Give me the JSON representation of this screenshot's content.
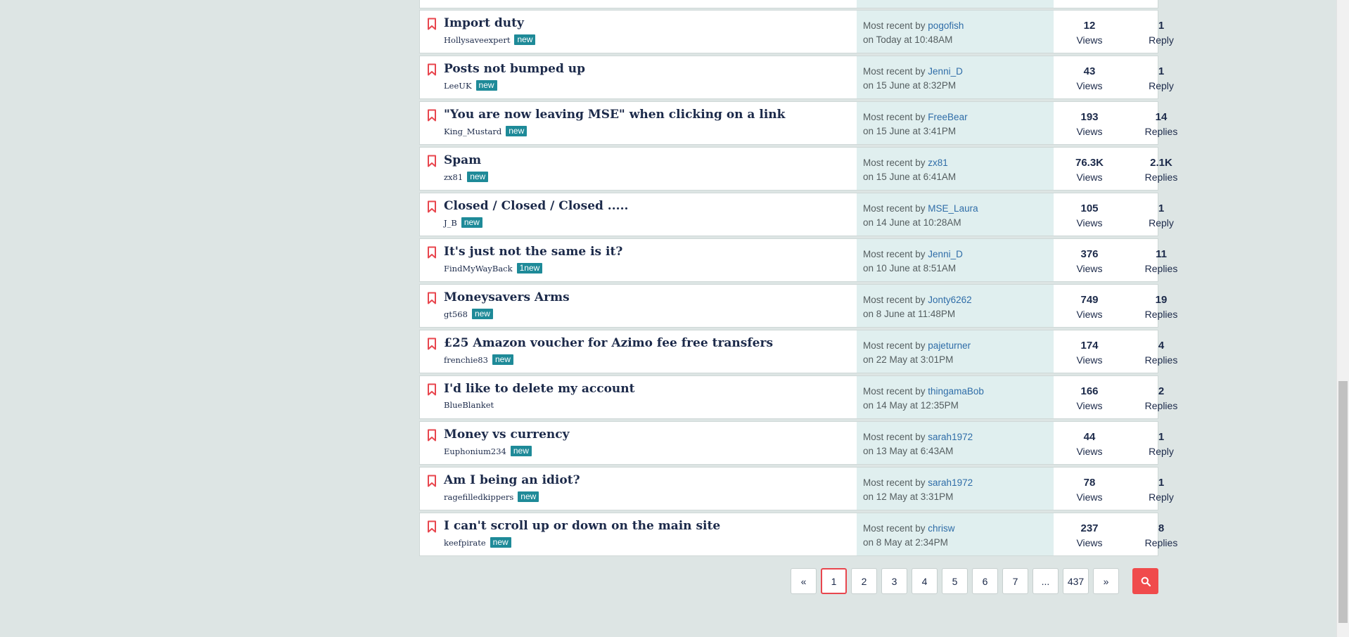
{
  "threads": [
    {
      "title": "Import duty",
      "author": "Hollysaveexpert",
      "badge": "new",
      "recent_prefix": "Most recent by ",
      "recent_user": "pogofish",
      "recent_time": "on Today at 10:48AM",
      "views": "12",
      "views_label": "Views",
      "replies": "1",
      "replies_label": "Reply"
    },
    {
      "title": "Posts not bumped up",
      "author": "LeeUK",
      "badge": "new",
      "recent_prefix": "Most recent by ",
      "recent_user": "Jenni_D",
      "recent_time": "on 15 June at 8:32PM",
      "views": "43",
      "views_label": "Views",
      "replies": "1",
      "replies_label": "Reply"
    },
    {
      "title": "\"You are now leaving MSE\" when clicking on a link",
      "author": "King_Mustard",
      "badge": "new",
      "recent_prefix": "Most recent by ",
      "recent_user": "FreeBear",
      "recent_time": "on 15 June at 3:41PM",
      "views": "193",
      "views_label": "Views",
      "replies": "14",
      "replies_label": "Replies"
    },
    {
      "title": "Spam",
      "author": "zx81",
      "badge": "new",
      "recent_prefix": "Most recent by ",
      "recent_user": "zx81",
      "recent_time": "on 15 June at 6:41AM",
      "views": "76.3K",
      "views_label": "Views",
      "replies": "2.1K",
      "replies_label": "Replies"
    },
    {
      "title": "Closed / Closed / Closed .....",
      "author": "J_B",
      "badge": "new",
      "recent_prefix": "Most recent by ",
      "recent_user": "MSE_Laura",
      "recent_time": "on 14 June at 10:28AM",
      "views": "105",
      "views_label": "Views",
      "replies": "1",
      "replies_label": "Reply"
    },
    {
      "title": "It's just not the same is it?",
      "author": "FindMyWayBack",
      "badge": "1new",
      "recent_prefix": "Most recent by ",
      "recent_user": "Jenni_D",
      "recent_time": "on 10 June at 8:51AM",
      "views": "376",
      "views_label": "Views",
      "replies": "11",
      "replies_label": "Replies"
    },
    {
      "title": "Moneysavers Arms",
      "author": "gt568",
      "badge": "new",
      "recent_prefix": "Most recent by ",
      "recent_user": "Jonty6262",
      "recent_time": "on 8 June at 11:48PM",
      "views": "749",
      "views_label": "Views",
      "replies": "19",
      "replies_label": "Replies"
    },
    {
      "title": "£25 Amazon voucher for Azimo fee free transfers",
      "author": "frenchie83",
      "badge": "new",
      "recent_prefix": "Most recent by ",
      "recent_user": "pajeturner",
      "recent_time": "on 22 May at 3:01PM",
      "views": "174",
      "views_label": "Views",
      "replies": "4",
      "replies_label": "Replies"
    },
    {
      "title": "I'd like to delete my account",
      "author": "BlueBlanket",
      "badge": "",
      "recent_prefix": "Most recent by ",
      "recent_user": "thingamaBob",
      "recent_time": "on 14 May at 12:35PM",
      "views": "166",
      "views_label": "Views",
      "replies": "2",
      "replies_label": "Replies"
    },
    {
      "title": "Money vs currency",
      "author": "Euphonium234",
      "badge": "new",
      "recent_prefix": "Most recent by ",
      "recent_user": "sarah1972",
      "recent_time": "on 13 May at 6:43AM",
      "views": "44",
      "views_label": "Views",
      "replies": "1",
      "replies_label": "Reply"
    },
    {
      "title": "Am I being an idiot?",
      "author": "ragefilledkippers",
      "badge": "new",
      "recent_prefix": "Most recent by ",
      "recent_user": "sarah1972",
      "recent_time": "on 12 May at 3:31PM",
      "views": "78",
      "views_label": "Views",
      "replies": "1",
      "replies_label": "Reply"
    },
    {
      "title": "I can't scroll up or down on the main site",
      "author": "keefpirate",
      "badge": "new",
      "recent_prefix": "Most recent by ",
      "recent_user": "chrisw",
      "recent_time": "on 8 May at 2:34PM",
      "views": "237",
      "views_label": "Views",
      "replies": "8",
      "replies_label": "Replies"
    }
  ],
  "pagination": {
    "prev": "«",
    "pages": [
      "1",
      "2",
      "3",
      "4",
      "5",
      "6",
      "7",
      "...",
      "437"
    ],
    "next": "»",
    "current": "1"
  },
  "icons": {
    "bookmark": "bookmark-icon",
    "search": "search-icon"
  },
  "colors": {
    "background": "#dde5e4",
    "bookmark": "#e8464e",
    "badge": "#1e8a98",
    "recent_column": "#e0efef",
    "link": "#2f6da8",
    "search_button": "#f04b4c"
  }
}
